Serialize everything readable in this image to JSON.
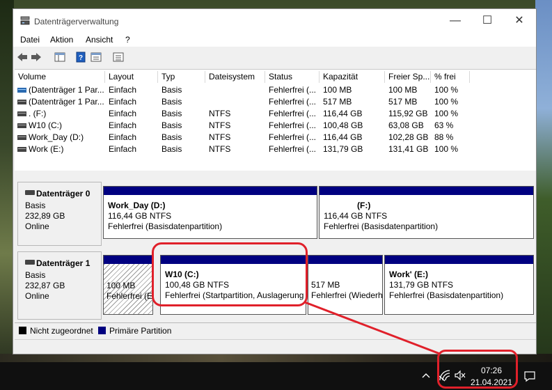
{
  "window": {
    "title": "Datenträgerverwaltung",
    "minimize": "—",
    "maximize": "☐",
    "close": "✕"
  },
  "menu": {
    "items": [
      "Datei",
      "Aktion",
      "Ansicht",
      "?"
    ]
  },
  "volume_list": {
    "columns": [
      "Volume",
      "Layout",
      "Typ",
      "Dateisystem",
      "Status",
      "Kapazität",
      "Freier Sp...",
      "% frei"
    ],
    "rows": [
      [
        "(Datenträger 1 Par...",
        "Einfach",
        "Basis",
        "",
        "Fehlerfrei (...",
        "100 MB",
        "100 MB",
        "100 %"
      ],
      [
        "(Datenträger 1 Par...",
        "Einfach",
        "Basis",
        "",
        "Fehlerfrei (...",
        "517 MB",
        "517 MB",
        "100 %"
      ],
      [
        ".          (F:)",
        "Einfach",
        "Basis",
        "NTFS",
        "Fehlerfrei (...",
        "116,44 GB",
        "115,92 GB",
        "100 %"
      ],
      [
        "W10 (C:)",
        "Einfach",
        "Basis",
        "NTFS",
        "Fehlerfrei (...",
        "100,48 GB",
        "63,08 GB",
        "63 %"
      ],
      [
        "Work_Day (D:)",
        "Einfach",
        "Basis",
        "NTFS",
        "Fehlerfrei (...",
        "116,44 GB",
        "102,28 GB",
        "88 %"
      ],
      [
        "Work       (E:)",
        "Einfach",
        "Basis",
        "NTFS",
        "Fehlerfrei (...",
        "131,79 GB",
        "131,41 GB",
        "100 %"
      ]
    ]
  },
  "disks": [
    {
      "title": "Datenträger 0",
      "type": "Basis",
      "size": "232,89 GB",
      "state": "Online",
      "partitions": [
        {
          "name": "Work_Day  (D:)",
          "size": "116,44 GB NTFS",
          "status": "Fehlerfrei (Basisdatenpartition)"
        },
        {
          "name": "(F:)",
          "size": "116,44 GB NTFS",
          "status": "Fehlerfrei (Basisdatenpartition)"
        }
      ]
    },
    {
      "title": "Datenträger 1",
      "type": "Basis",
      "size": "232,87 GB",
      "state": "Online",
      "partitions": [
        {
          "name": "",
          "size": "100 MB",
          "status": "Fehlerfrei (EF"
        },
        {
          "name": "W10  (C:)",
          "size": "100,48 GB NTFS",
          "status": "Fehlerfrei (Startpartition, Auslagerung"
        },
        {
          "name": "",
          "size": "517 MB",
          "status": "Fehlerfrei (Wiederh"
        },
        {
          "name": "Work'       (E:)",
          "size": "131,79 GB NTFS",
          "status": "Fehlerfrei (Basisdatenpartition)"
        }
      ]
    }
  ],
  "legend": {
    "unallocated": "Nicht zugeordnet",
    "primary": "Primäre Partition"
  },
  "taskbar": {
    "time": "07:26",
    "date": "21.04.2021"
  },
  "colors": {
    "partition_bar": "#000080",
    "annotation": "#e0202a",
    "taskbar": "#101010"
  }
}
